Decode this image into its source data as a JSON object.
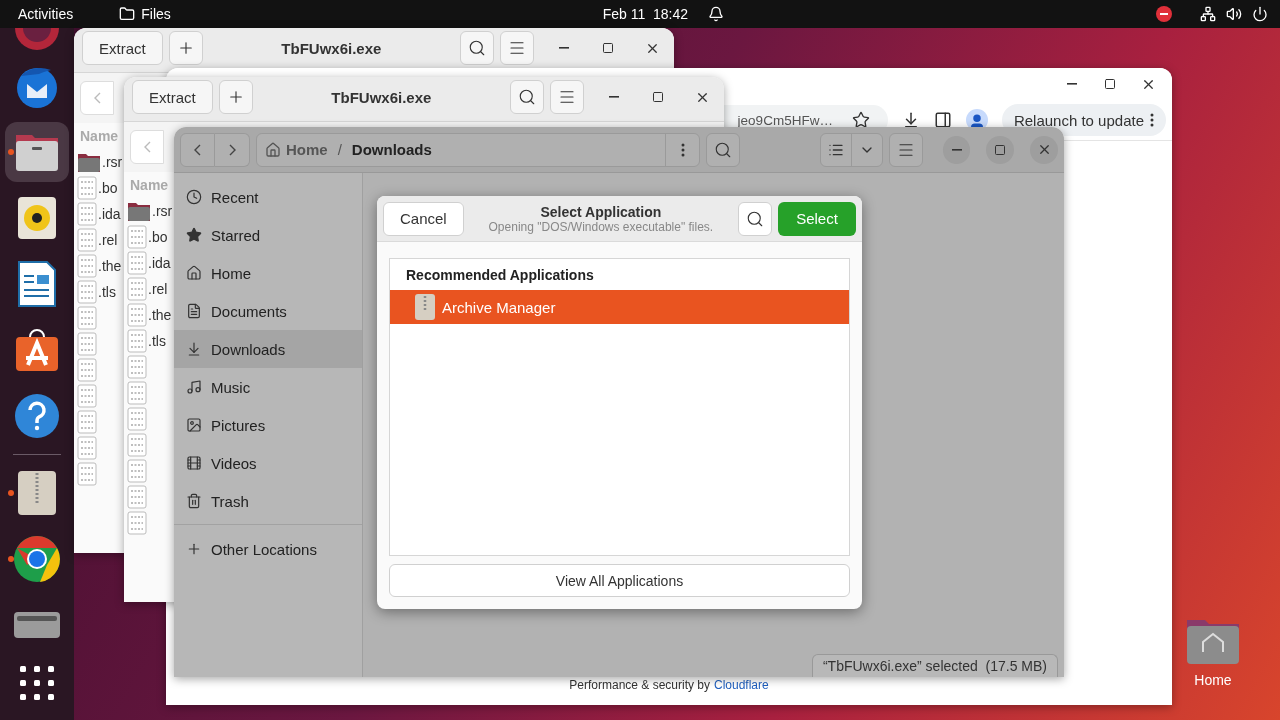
{
  "top_bar": {
    "activities": "Activities",
    "app_name": "Files",
    "clock": "Feb 11  18:42"
  },
  "dock": {
    "favorites": [
      {
        "kind": "firefox",
        "running": false,
        "selected": false
      },
      {
        "kind": "thunderbird",
        "running": false,
        "selected": false
      },
      {
        "kind": "files",
        "running": true,
        "selected": true
      },
      {
        "kind": "rhythmbox",
        "running": false,
        "selected": false
      },
      {
        "kind": "writer",
        "running": false,
        "selected": false
      },
      {
        "kind": "appcenter",
        "running": false,
        "selected": false
      },
      {
        "kind": "help",
        "running": false,
        "selected": false
      }
    ],
    "others": [
      {
        "kind": "archive",
        "running": true,
        "selected": false
      },
      {
        "kind": "chrome",
        "running": true,
        "selected": false
      },
      {
        "kind": "drive",
        "running": false,
        "selected": false
      },
      {
        "kind": "apps",
        "running": false,
        "selected": false
      }
    ]
  },
  "archive_windows": [
    {
      "title": "TbFUwx6i.exe",
      "extract": "Extract",
      "column": "Name",
      "rows": [
        {
          "kind": "folder",
          "name": ".rsr"
        },
        {
          "kind": "binary",
          "name": ".bo"
        },
        {
          "kind": "binary",
          "name": ".ida"
        },
        {
          "kind": "binary",
          "name": ".rel"
        },
        {
          "kind": "binary",
          "name": ".the"
        },
        {
          "kind": "binary",
          "name": ".tls"
        },
        {
          "kind": "binary"
        },
        {
          "kind": "binary"
        },
        {
          "kind": "binary"
        },
        {
          "kind": "binary"
        },
        {
          "kind": "binary"
        },
        {
          "kind": "binary"
        },
        {
          "kind": "binary"
        }
      ]
    },
    {
      "title": "TbFUwx6i.exe",
      "extract": "Extract",
      "column": "Name",
      "rows": [
        {
          "kind": "folder",
          "name": ".rsr"
        },
        {
          "kind": "binary",
          "name": ".bo"
        },
        {
          "kind": "binary",
          "name": ".ida"
        },
        {
          "kind": "binary",
          "name": ".rel"
        },
        {
          "kind": "binary",
          "name": ".the"
        },
        {
          "kind": "binary",
          "name": ".tls"
        },
        {
          "kind": "binary"
        },
        {
          "kind": "binary"
        },
        {
          "kind": "binary"
        },
        {
          "kind": "binary"
        },
        {
          "kind": "binary"
        },
        {
          "kind": "binary"
        },
        {
          "kind": "binary"
        }
      ]
    }
  ],
  "browser": {
    "address": "jeo9Cm5HFw…",
    "relaunch": "Relaunch to update",
    "footer": "Performance & security by",
    "footer_link": "Cloudflare"
  },
  "files": {
    "path": [
      {
        "label": "Home"
      },
      {
        "label": "Downloads"
      }
    ],
    "path_separator": "/",
    "sidebar": [
      {
        "kind": "recent",
        "label": "Recent",
        "selected": false
      },
      {
        "kind": "starred",
        "label": "Starred",
        "selected": false
      },
      {
        "kind": "home",
        "label": "Home",
        "selected": false
      },
      {
        "kind": "documents",
        "label": "Documents",
        "selected": false
      },
      {
        "kind": "downloads",
        "label": "Downloads",
        "selected": true
      },
      {
        "kind": "music",
        "label": "Music",
        "selected": false
      },
      {
        "kind": "pictures",
        "label": "Pictures",
        "selected": false
      },
      {
        "kind": "videos",
        "label": "Videos",
        "selected": false
      },
      {
        "kind": "trash",
        "label": "Trash",
        "selected": false
      },
      {
        "kind": "other",
        "label": "Other Locations",
        "selected": false
      }
    ],
    "status": "“TbFUwx6i.exe” selected  (17.5 MB)"
  },
  "dialog": {
    "cancel": "Cancel",
    "title": "Select Application",
    "subtitle": "Opening \"DOS/Windows executable\" files.",
    "select": "Select",
    "section": "Recommended Applications",
    "apps": [
      {
        "name": "Archive Manager",
        "selected": true
      }
    ],
    "view_all": "View All Applications"
  },
  "desktop": [
    {
      "label": "Home"
    }
  ]
}
